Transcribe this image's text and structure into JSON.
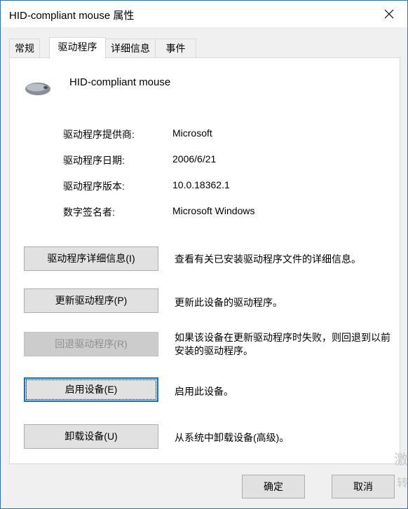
{
  "window": {
    "title": "HID-compliant mouse 属性"
  },
  "tabs": [
    {
      "label": "常规"
    },
    {
      "label": "驱动程序"
    },
    {
      "label": "详细信息"
    },
    {
      "label": "事件"
    }
  ],
  "device": {
    "name": "HID-compliant mouse",
    "icon": "mouse-icon"
  },
  "props": [
    {
      "label": "驱动程序提供商:",
      "value": "Microsoft"
    },
    {
      "label": "驱动程序日期:",
      "value": "2006/6/21"
    },
    {
      "label": "驱动程序版本:",
      "value": "10.0.18362.1"
    },
    {
      "label": "数字签名者:",
      "value": "Microsoft Windows"
    }
  ],
  "actions": [
    {
      "button": "驱动程序详细信息(I)",
      "desc": "查看有关已安装驱动程序文件的详细信息。",
      "enabled": true
    },
    {
      "button": "更新驱动程序(P)",
      "desc": "更新此设备的驱动程序。",
      "enabled": true
    },
    {
      "button": "回退驱动程序(R)",
      "desc": "如果该设备在更新驱动程序时失败，则回退到以前安装的驱动程序。",
      "enabled": false
    },
    {
      "button": "启用设备(E)",
      "desc": "启用此设备。",
      "enabled": true,
      "focused": true
    },
    {
      "button": "卸载设备(U)",
      "desc": "从系统中卸载设备(高级)。",
      "enabled": true
    }
  ],
  "footer": {
    "ok": "确定",
    "cancel": "取消"
  },
  "watermark": {
    "line1": "激",
    "line2": "转"
  }
}
